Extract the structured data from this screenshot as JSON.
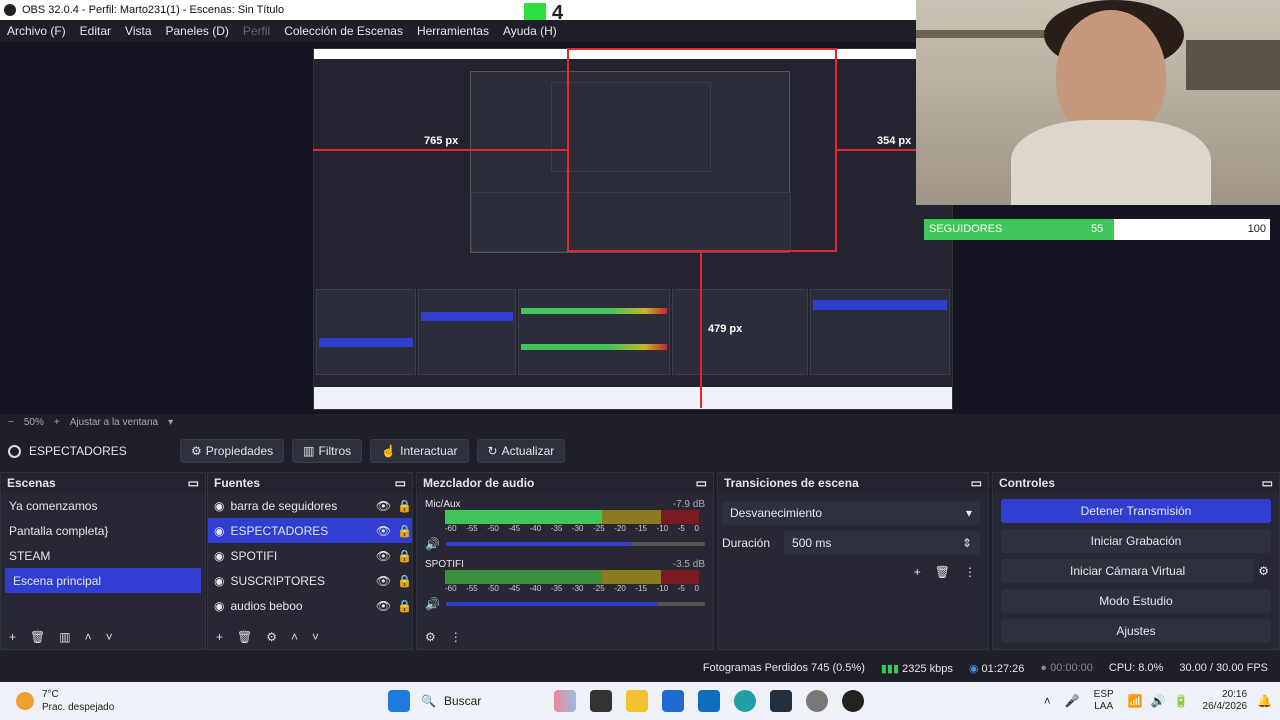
{
  "window": {
    "title": "OBS 32.0.4 - Perfil: Marto231(1) - Escenas: Sin Título"
  },
  "overlay_text": "4",
  "menu": [
    "Archivo (F)",
    "Editar",
    "Vista",
    "Paneles (D)",
    "Perfil",
    "Colección de Escenas",
    "Herramientas",
    "Ayuda (H)"
  ],
  "preview": {
    "label_left": "765 px",
    "label_right": "354 px",
    "label_bottom": "479 px",
    "zoom": "50%",
    "fit_label": "Ajustar a la ventana"
  },
  "follower_bar": {
    "label": "SEGUIDORES",
    "current": "55",
    "max": "100",
    "fraction": 0.55,
    "color": "#3ec65a"
  },
  "source_toolbar": {
    "current_source": "ESPECTADORES",
    "buttons": [
      "Propiedades",
      "Filtros",
      "Interactuar",
      "Actualizar"
    ]
  },
  "scenes": {
    "title": "Escenas",
    "items": [
      "Ya comenzamos",
      "Pantalla completa}",
      "STEAM",
      "Escena principal"
    ],
    "selected": 3
  },
  "sources": {
    "title": "Fuentes",
    "items": [
      "barra de seguidores",
      "ESPECTADORES",
      "SPOTIFI",
      "SUSCRIPTORES",
      "audios beboo"
    ],
    "selected": 1
  },
  "mixer": {
    "title": "Mezclador de audio",
    "channels": [
      {
        "name": "Mic/Aux",
        "db": "-7.9 dB",
        "volume": 0.72
      },
      {
        "name": "SPOTIFI",
        "db": "-3.5 dB",
        "volume": 0.82
      }
    ],
    "ticks": [
      "-60",
      "-55",
      "-50",
      "-45",
      "-40",
      "-35",
      "-30",
      "-25",
      "-20",
      "-15",
      "-10",
      "-5",
      "0"
    ]
  },
  "transitions": {
    "title": "Transiciones de escena",
    "selected": "Desvanecimiento",
    "duration_label": "Duración",
    "duration_value": "500 ms"
  },
  "controls": {
    "title": "Controles",
    "buttons": [
      "Detener Transmisión",
      "Iniciar Grabación",
      "Iniciar Cámara Virtual",
      "Modo Estudio",
      "Ajustes"
    ]
  },
  "status": {
    "dropped": "Fotogramas Perdidos 745 (0.5%)",
    "bitrate": "2325 kbps",
    "stream_time": "01:27:26",
    "rec_time": "00:00:00",
    "cpu": "CPU: 8.0%",
    "fps": "30.00 / 30.00 FPS"
  },
  "taskbar": {
    "temp": "7°C",
    "weather": "Prac. despejado",
    "search": "Buscar",
    "lang1": "ESP",
    "lang2": "LAA",
    "time": "20:16",
    "date": "26/4/2026"
  },
  "colors": {
    "accent": "#2f3ed1",
    "meter_green": "#3ec65a",
    "meter_yellow": "#c9b22c",
    "meter_red": "#c8262e",
    "guide_red": "#e8242c"
  }
}
